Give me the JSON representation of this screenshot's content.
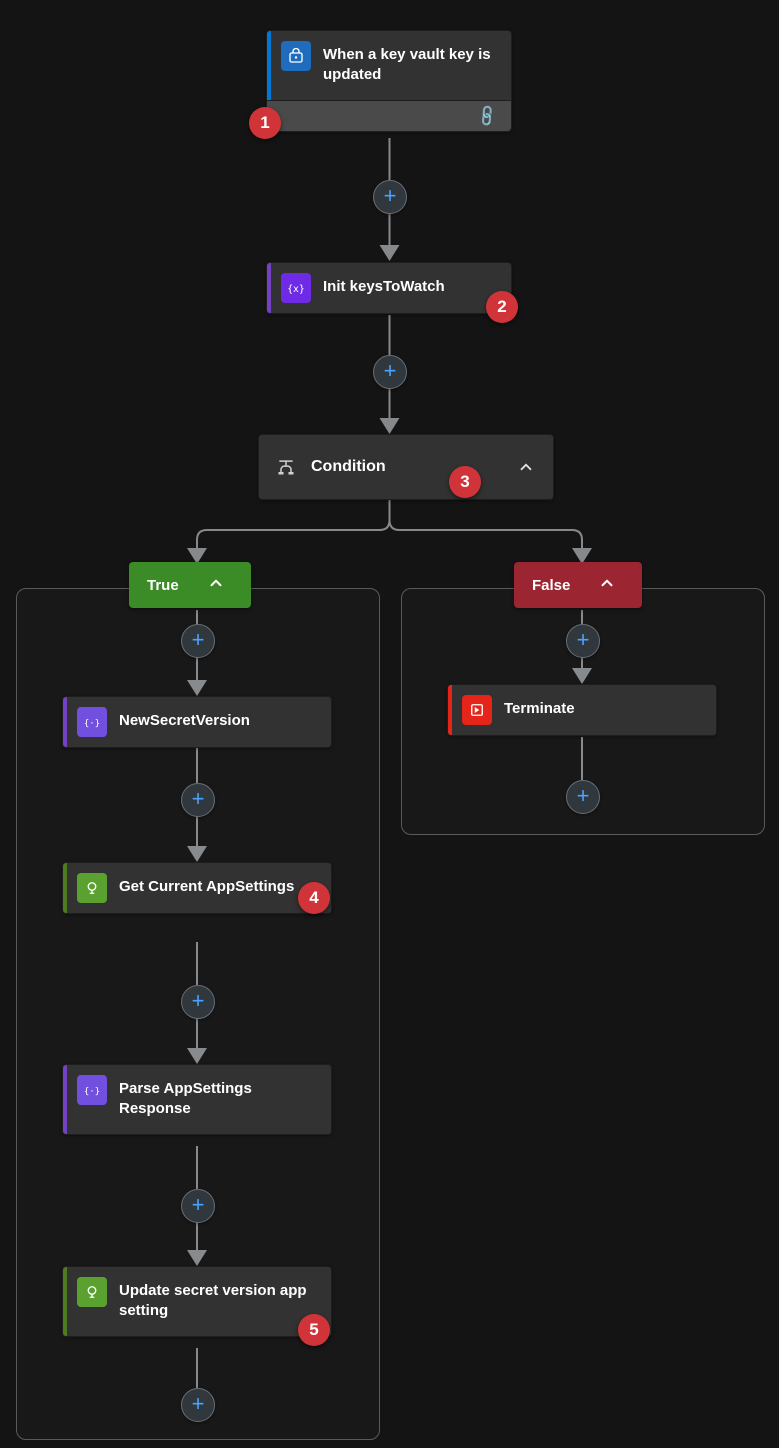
{
  "trigger": {
    "label": "When a key vault key is updated",
    "icon_name": "key-vault-icon",
    "accent_color": "#0078d4",
    "icon_bg": "#1f6cbf",
    "footer_icon": "link-icon"
  },
  "init_var": {
    "label": "Init keysToWatch",
    "icon_name": "variable-icon",
    "accent_color": "#7341c4",
    "icon_bg": "#6f2ae6"
  },
  "condition": {
    "label": "Condition",
    "icon_name": "condition-branch-icon",
    "true_label": "True",
    "false_label": "False"
  },
  "true_branch": {
    "steps": [
      {
        "label": "NewSecretVersion",
        "accent": "#7341c4",
        "icon_bg": "#7150e0",
        "icon_name": "data-operation-icon"
      },
      {
        "label": "Get Current AppSettings",
        "accent": "#4e7b1f",
        "icon_bg": "#5aa12f",
        "icon_name": "arm-icon"
      },
      {
        "label": "Parse AppSettings Response",
        "accent": "#7341c4",
        "icon_bg": "#7150e0",
        "icon_name": "data-operation-icon"
      },
      {
        "label": "Update secret version app setting",
        "accent": "#4e7b1f",
        "icon_bg": "#5aa12f",
        "icon_name": "arm-icon"
      }
    ]
  },
  "false_branch": {
    "steps": [
      {
        "label": "Terminate",
        "accent": "#e5251a",
        "icon_bg": "#e5251a",
        "icon_name": "terminate-icon"
      }
    ]
  },
  "markers": {
    "m1": "1",
    "m2": "2",
    "m3": "3",
    "m4": "4",
    "m5": "5"
  },
  "chart_data": {
    "type": "flow",
    "nodes": [
      {
        "id": "trigger",
        "label": "When a key vault key is updated",
        "kind": "trigger"
      },
      {
        "id": "init",
        "label": "Init keysToWatch",
        "kind": "initialize-variable"
      },
      {
        "id": "cond",
        "label": "Condition",
        "kind": "condition"
      },
      {
        "id": "true",
        "label": "True",
        "kind": "branch"
      },
      {
        "id": "false",
        "label": "False",
        "kind": "branch"
      },
      {
        "id": "t1",
        "label": "NewSecretVersion",
        "kind": "data-operation"
      },
      {
        "id": "t2",
        "label": "Get Current AppSettings",
        "kind": "arm"
      },
      {
        "id": "t3",
        "label": "Parse AppSettings Response",
        "kind": "data-operation"
      },
      {
        "id": "t4",
        "label": "Update secret version app setting",
        "kind": "arm"
      },
      {
        "id": "f1",
        "label": "Terminate",
        "kind": "terminate"
      }
    ],
    "edges": [
      [
        "trigger",
        "init"
      ],
      [
        "init",
        "cond"
      ],
      [
        "cond",
        "true"
      ],
      [
        "cond",
        "false"
      ],
      [
        "true",
        "t1"
      ],
      [
        "t1",
        "t2"
      ],
      [
        "t2",
        "t3"
      ],
      [
        "t3",
        "t4"
      ],
      [
        "false",
        "f1"
      ]
    ],
    "annotations": [
      {
        "marker": 1,
        "on": "trigger"
      },
      {
        "marker": 2,
        "on": "init"
      },
      {
        "marker": 3,
        "on": "cond"
      },
      {
        "marker": 4,
        "on": "t2"
      },
      {
        "marker": 5,
        "on": "t4"
      }
    ]
  }
}
